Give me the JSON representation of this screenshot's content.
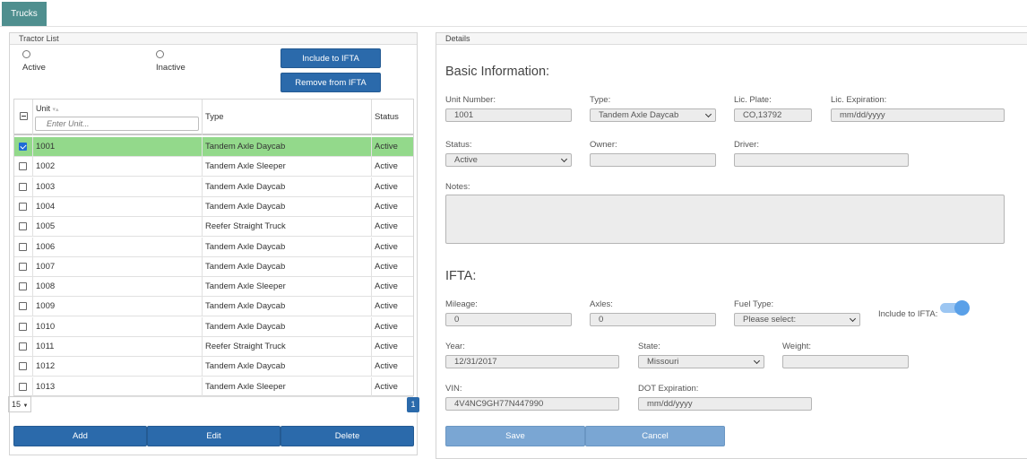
{
  "tabs": [
    {
      "label": "Trucks"
    }
  ],
  "tractor_list": {
    "title": "Tractor List",
    "filter_active": "Active",
    "filter_inactive": "Inactive",
    "include_ifta_button": "Include to IFTA",
    "remove_ifta_button": "Remove from IFTA",
    "columns": {
      "unit": "Unit",
      "type": "Type",
      "status": "Status"
    },
    "unit_filter_placeholder": "Enter Unit...",
    "rows": [
      {
        "unit": "1001",
        "type": "Tandem Axle Daycab",
        "status": "Active",
        "selected": true
      },
      {
        "unit": "1002",
        "type": "Tandem Axle Sleeper",
        "status": "Active",
        "selected": false
      },
      {
        "unit": "1003",
        "type": "Tandem Axle Daycab",
        "status": "Active",
        "selected": false
      },
      {
        "unit": "1004",
        "type": "Tandem Axle Daycab",
        "status": "Active",
        "selected": false
      },
      {
        "unit": "1005",
        "type": "Reefer Straight Truck",
        "status": "Active",
        "selected": false
      },
      {
        "unit": "1006",
        "type": "Tandem Axle Daycab",
        "status": "Active",
        "selected": false
      },
      {
        "unit": "1007",
        "type": "Tandem Axle Daycab",
        "status": "Active",
        "selected": false
      },
      {
        "unit": "1008",
        "type": "Tandem Axle Sleeper",
        "status": "Active",
        "selected": false
      },
      {
        "unit": "1009",
        "type": "Tandem Axle Daycab",
        "status": "Active",
        "selected": false
      },
      {
        "unit": "1010",
        "type": "Tandem Axle Daycab",
        "status": "Active",
        "selected": false
      },
      {
        "unit": "1011",
        "type": "Reefer Straight Truck",
        "status": "Active",
        "selected": false
      },
      {
        "unit": "1012",
        "type": "Tandem Axle Daycab",
        "status": "Active",
        "selected": false
      },
      {
        "unit": "1013",
        "type": "Tandem Axle Sleeper",
        "status": "Active",
        "selected": false
      }
    ],
    "page_size": "15",
    "current_page": "1",
    "add_button": "Add",
    "edit_button": "Edit",
    "delete_button": "Delete"
  },
  "details": {
    "title": "Details",
    "basic_heading": "Basic Information:",
    "unit_number_label": "Unit Number:",
    "unit_number": "1001",
    "type_label": "Type:",
    "type_value": "Tandem Axle Daycab",
    "lic_plate_label": "Lic. Plate:",
    "lic_plate": "CO,13792",
    "lic_expiration_label": "Lic. Expiration:",
    "lic_expiration_placeholder": "mm/dd/yyyy",
    "status_label": "Status:",
    "status_value": "Active",
    "owner_label": "Owner:",
    "owner_value": "",
    "driver_label": "Driver:",
    "driver_value": "",
    "notes_label": "Notes:",
    "notes_value": "",
    "ifta_heading": "IFTA:",
    "mileage_label": "Mileage:",
    "mileage": "0",
    "axles_label": "Axles:",
    "axles": "0",
    "fuel_type_label": "Fuel Type:",
    "fuel_type_value": "Please select:",
    "include_ifta_label": "Include to IFTA:",
    "include_ifta_on": true,
    "year_label": "Year:",
    "year_value": "12/31/2017",
    "state_label": "State:",
    "state_value": "Missouri",
    "weight_label": "Weight:",
    "weight_value": "",
    "vin_label": "VIN:",
    "vin_value": "4V4NC9GH77N447990",
    "dot_expiration_label": "DOT Expiration:",
    "dot_expiration_placeholder": "mm/dd/yyyy",
    "save_button": "Save",
    "cancel_button": "Cancel"
  },
  "colors": {
    "tab": "#4f8f8f",
    "primary_button": "#2b6aab",
    "selected_row": "#93d98b",
    "disabled_button": "#7aa6d3",
    "toggle": "#5aa0e8"
  }
}
